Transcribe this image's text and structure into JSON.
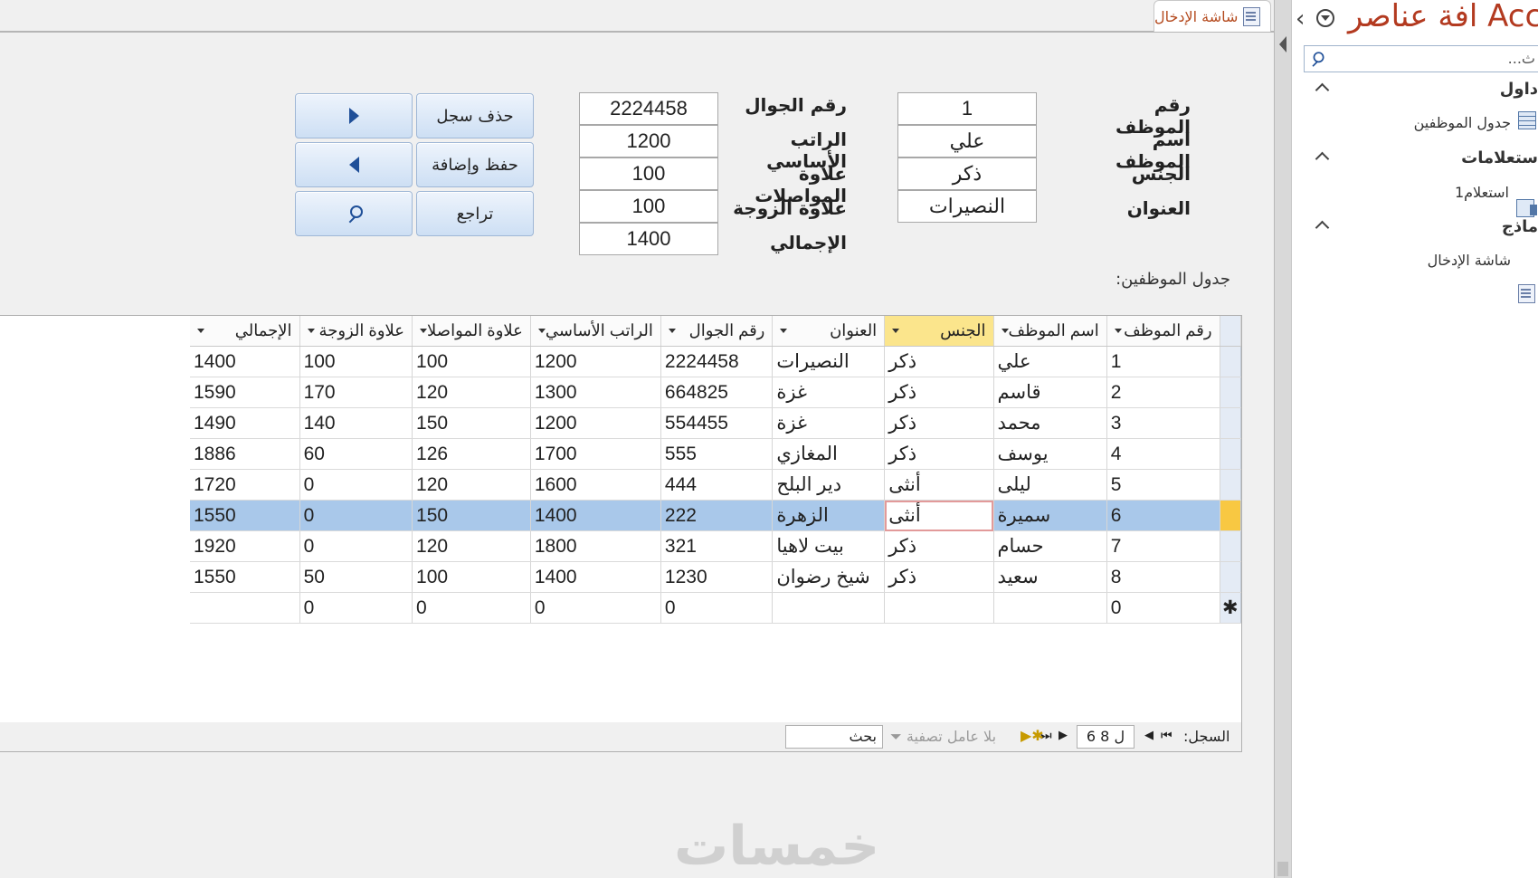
{
  "document_tab": {
    "label": "شاشة الإدخال"
  },
  "nav_pane": {
    "title": "افة عناصر Access",
    "search_placeholder": "ث...",
    "groups": [
      {
        "label": "داول",
        "items": [
          {
            "label": "جدول الموظفين",
            "icon": "table-icon"
          }
        ]
      },
      {
        "label": "ستعلامات",
        "items": [
          {
            "label": "استعلام1",
            "icon": "query-icon"
          }
        ]
      },
      {
        "label": "ماذج",
        "items": [
          {
            "label": "شاشة الإدخال",
            "icon": "form-icon"
          }
        ]
      }
    ]
  },
  "form": {
    "fields_right": [
      {
        "label": "رقم الموظف",
        "value": "1"
      },
      {
        "label": "اسم الموظف",
        "value": "علي"
      },
      {
        "label": "الجنس",
        "value": "ذكر"
      },
      {
        "label": "العنوان",
        "value": "النصيرات"
      }
    ],
    "fields_left": [
      {
        "label": "رقم الجوال",
        "value": "2224458"
      },
      {
        "label": "الراتب الأساسي",
        "value": "1200"
      },
      {
        "label": "علاوة المواصلات",
        "value": "100"
      },
      {
        "label": "علاوة الزوجة",
        "value": "100"
      },
      {
        "label": "الإجمالي",
        "value": "1400"
      }
    ],
    "buttons": {
      "delete": "حذف سجل",
      "save_add": "حفظ وإضافة",
      "undo": "تراجع"
    },
    "subform_label": "جدول الموظفين:"
  },
  "datasheet": {
    "columns": [
      "رقم الموظف",
      "اسم الموظف",
      "الجنس",
      "العنوان",
      "رقم الجوال",
      "الراتب الأساسي",
      "علاوة المواصلا",
      "علاوة الزوجة",
      "الإجمالي"
    ],
    "rows": [
      [
        "1",
        "علي",
        "ذكر",
        "النصيرات",
        "2224458",
        "1200",
        "100",
        "100",
        "1400"
      ],
      [
        "2",
        "قاسم",
        "ذكر",
        "غزة",
        "664825",
        "1300",
        "120",
        "170",
        "1590"
      ],
      [
        "3",
        "محمد",
        "ذكر",
        "غزة",
        "554455",
        "1200",
        "150",
        "140",
        "1490"
      ],
      [
        "4",
        "يوسف",
        "ذكر",
        "المغازي",
        "555",
        "1700",
        "126",
        "60",
        "1886"
      ],
      [
        "5",
        "ليلى",
        "أنثى",
        "دير البلح",
        "444",
        "1600",
        "120",
        "0",
        "1720"
      ],
      [
        "6",
        "سميرة",
        "أنثى",
        "الزهرة",
        "222",
        "1400",
        "150",
        "0",
        "1550"
      ],
      [
        "7",
        "حسام",
        "ذكر",
        "بيت لاهيا",
        "321",
        "1800",
        "120",
        "0",
        "1920"
      ],
      [
        "8",
        "سعيد",
        "ذكر",
        "شيخ رضوان",
        "1230",
        "1400",
        "100",
        "50",
        "1550"
      ]
    ],
    "new_row": [
      "0",
      "",
      "",
      "",
      "0",
      "0",
      "0",
      "0",
      ""
    ],
    "current_row_index": 5
  },
  "record_nav": {
    "label": "السجل:",
    "position": "6 ل 8",
    "filter": "بلا عامل تصفية",
    "search": "بحث"
  },
  "watermark": "خمسات"
}
